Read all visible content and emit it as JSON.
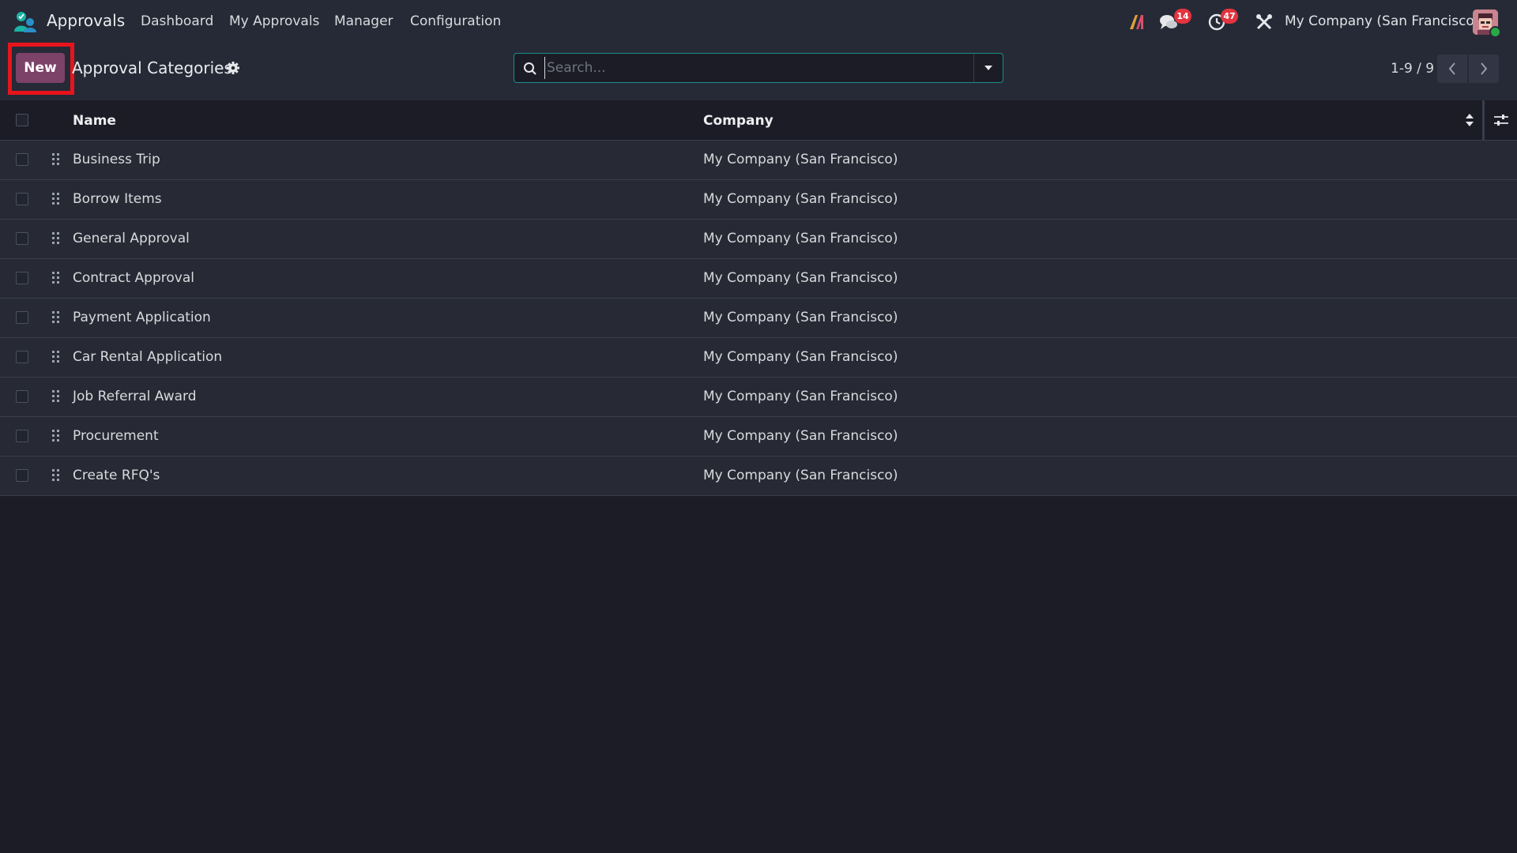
{
  "navbar": {
    "app_name": "Approvals",
    "menu": [
      "Dashboard",
      "My Approvals",
      "Manager",
      "Configuration"
    ],
    "messages_count": "14",
    "activities_count": "47",
    "company": "My Company (San Francisco)"
  },
  "control_panel": {
    "new_label": "New",
    "title": "Approval Categories",
    "search_placeholder": "Search...",
    "pager": "1-9 / 9"
  },
  "list": {
    "columns": [
      "Name",
      "Company"
    ],
    "rows": [
      {
        "name": "Business Trip",
        "company": "My Company (San Francisco)"
      },
      {
        "name": "Borrow Items",
        "company": "My Company (San Francisco)"
      },
      {
        "name": "General Approval",
        "company": "My Company (San Francisco)"
      },
      {
        "name": "Contract Approval",
        "company": "My Company (San Francisco)"
      },
      {
        "name": "Payment Application",
        "company": "My Company (San Francisco)"
      },
      {
        "name": "Car Rental Application",
        "company": "My Company (San Francisco)"
      },
      {
        "name": "Job Referral Award",
        "company": "My Company (San Francisco)"
      },
      {
        "name": "Procurement",
        "company": "My Company (San Francisco)"
      },
      {
        "name": "Create RFQ's",
        "company": "My Company (San Francisco)"
      }
    ]
  },
  "colors": {
    "background": "#1b1c26",
    "navbar": "#262a36",
    "primary_button": "#7c4268",
    "highlight": "#e8141c",
    "badge": "#e3343f",
    "search_focus": "#1d8c8a"
  },
  "icons": [
    "approvals-app-icon",
    "ai-icon",
    "chat-icon",
    "activity-clock-icon",
    "debug-tools-icon",
    "user-avatar",
    "gear-icon",
    "search-icon",
    "caret-down-icon",
    "chevron-left-icon",
    "chevron-right-icon",
    "sort-icon",
    "column-settings-icon",
    "drag-handle-icon"
  ]
}
